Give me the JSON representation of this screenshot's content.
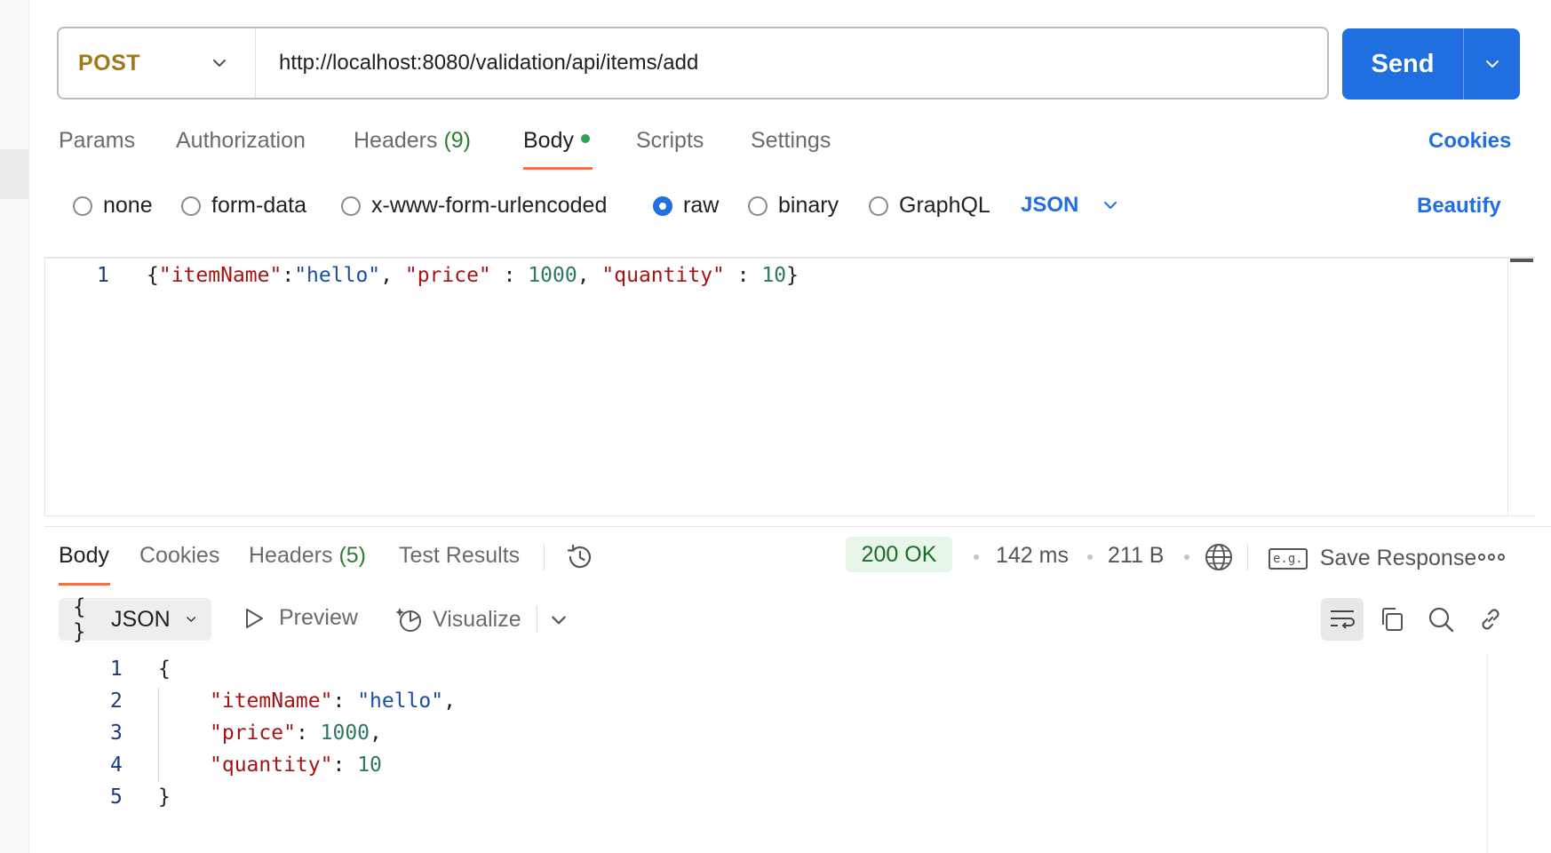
{
  "request": {
    "method": "POST",
    "url": "http://localhost:8080/validation/api/items/add",
    "send_label": "Send"
  },
  "request_tabs": {
    "params": "Params",
    "authorization": "Authorization",
    "headers": "Headers",
    "headers_count": "(9)",
    "body": "Body",
    "scripts": "Scripts",
    "settings": "Settings",
    "cookies": "Cookies"
  },
  "body_types": {
    "none": "none",
    "form_data": "form-data",
    "urlencoded": "x-www-form-urlencoded",
    "raw": "raw",
    "binary": "binary",
    "graphql": "GraphQL",
    "language": "JSON",
    "beautify": "Beautify",
    "selected": "raw"
  },
  "request_body": {
    "line_number": "1",
    "k1": "\"itemName\"",
    "v1": "\"hello\"",
    "k2": "\"price\"",
    "v2": "1000",
    "k3": "\"quantity\"",
    "v3": "10"
  },
  "response_tabs": {
    "body": "Body",
    "cookies": "Cookies",
    "headers": "Headers",
    "headers_count": "(5)",
    "test_results": "Test Results"
  },
  "response_meta": {
    "status": "200 OK",
    "time": "142 ms",
    "size": "211 B",
    "save_response": "Save Response",
    "eg": "e.g."
  },
  "response_toolbar": {
    "format": "JSON",
    "format_brace": "{ }",
    "preview": "Preview",
    "visualize": "Visualize"
  },
  "response_body": {
    "lines": [
      "1",
      "2",
      "3",
      "4",
      "5"
    ],
    "open": "{",
    "close": "}",
    "k1": "\"itemName\"",
    "v1": "\"hello\"",
    "k2": "\"price\"",
    "v2": "1000",
    "k3": "\"quantity\"",
    "v3": "10"
  },
  "colors": {
    "accent": "#1f6fe0",
    "method_post": "#a0781a",
    "tab_underline": "#ff6c37",
    "status_ok_bg": "#e8f5e9",
    "status_ok_text": "#1b6b2a"
  }
}
